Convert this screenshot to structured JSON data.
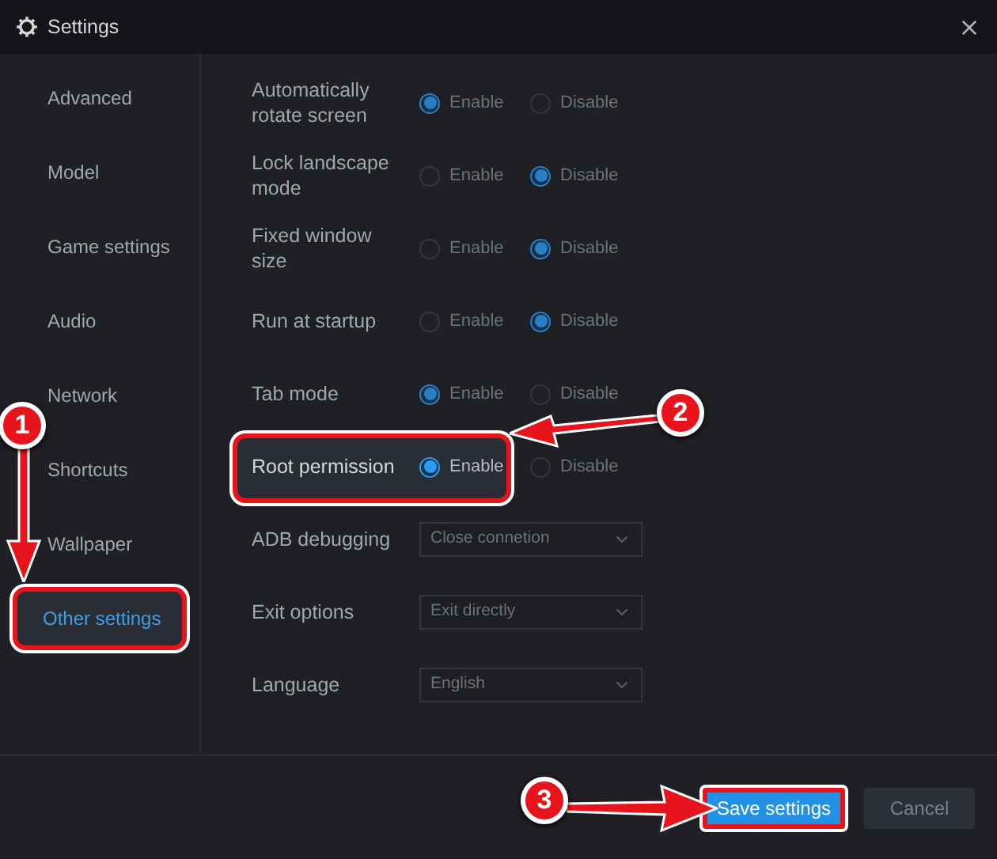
{
  "window": {
    "title": "Settings"
  },
  "sidebar": {
    "items": [
      {
        "label": "Advanced",
        "selected": false
      },
      {
        "label": "Model",
        "selected": false
      },
      {
        "label": "Game settings",
        "selected": false
      },
      {
        "label": "Audio",
        "selected": false
      },
      {
        "label": "Network",
        "selected": false
      },
      {
        "label": "Shortcuts",
        "selected": false
      },
      {
        "label": "Wallpaper",
        "selected": false
      },
      {
        "label": "Other settings",
        "selected": true
      }
    ]
  },
  "settings": [
    {
      "kind": "radio",
      "label": "Automatically rotate screen",
      "options": [
        {
          "label": "Enable",
          "selected": true
        },
        {
          "label": "Disable",
          "selected": false
        }
      ]
    },
    {
      "kind": "radio",
      "label": "Lock landscape mode",
      "options": [
        {
          "label": "Enable",
          "selected": false
        },
        {
          "label": "Disable",
          "selected": true
        }
      ]
    },
    {
      "kind": "radio",
      "label": "Fixed window size",
      "options": [
        {
          "label": "Enable",
          "selected": false
        },
        {
          "label": "Disable",
          "selected": true
        }
      ]
    },
    {
      "kind": "radio",
      "label": "Run at startup",
      "options": [
        {
          "label": "Enable",
          "selected": false
        },
        {
          "label": "Disable",
          "selected": true
        }
      ]
    },
    {
      "kind": "radio",
      "label": "Tab mode",
      "options": [
        {
          "label": "Enable",
          "selected": true
        },
        {
          "label": "Disable",
          "selected": false
        }
      ]
    },
    {
      "kind": "radio",
      "label": "Root permission",
      "highlighted": true,
      "options": [
        {
          "label": "Enable",
          "selected": true
        },
        {
          "label": "Disable",
          "selected": false
        }
      ]
    },
    {
      "kind": "select",
      "label": "ADB debugging",
      "value": "Close connetion"
    },
    {
      "kind": "select",
      "label": "Exit options",
      "value": "Exit directly"
    },
    {
      "kind": "select",
      "label": "Language",
      "value": "English"
    }
  ],
  "footer": {
    "buttons": [
      {
        "label": "Save settings",
        "kind": "primary"
      },
      {
        "label": "Cancel",
        "kind": "secondary"
      }
    ]
  },
  "annotations": [
    {
      "number": "1"
    },
    {
      "number": "2"
    },
    {
      "number": "3"
    }
  ]
}
